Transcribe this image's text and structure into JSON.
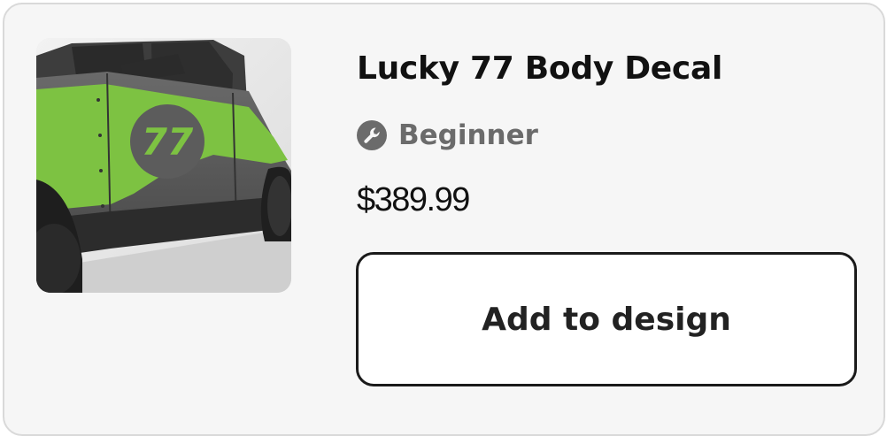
{
  "product": {
    "title": "Lucky 77 Body Decal",
    "level_icon": "wrench-icon",
    "level": "Beginner",
    "price": "$389.99",
    "decal_number": "77",
    "image_alt": "Truck side with green Lucky 77 decal"
  },
  "actions": {
    "add_label": "Add to design"
  },
  "colors": {
    "card_bg": "#f6f6f6",
    "card_border": "#d9d9d9",
    "decal_green": "#7dc242",
    "truck_gray": "#5a5a5a",
    "muted_text": "#6b6b6b"
  }
}
